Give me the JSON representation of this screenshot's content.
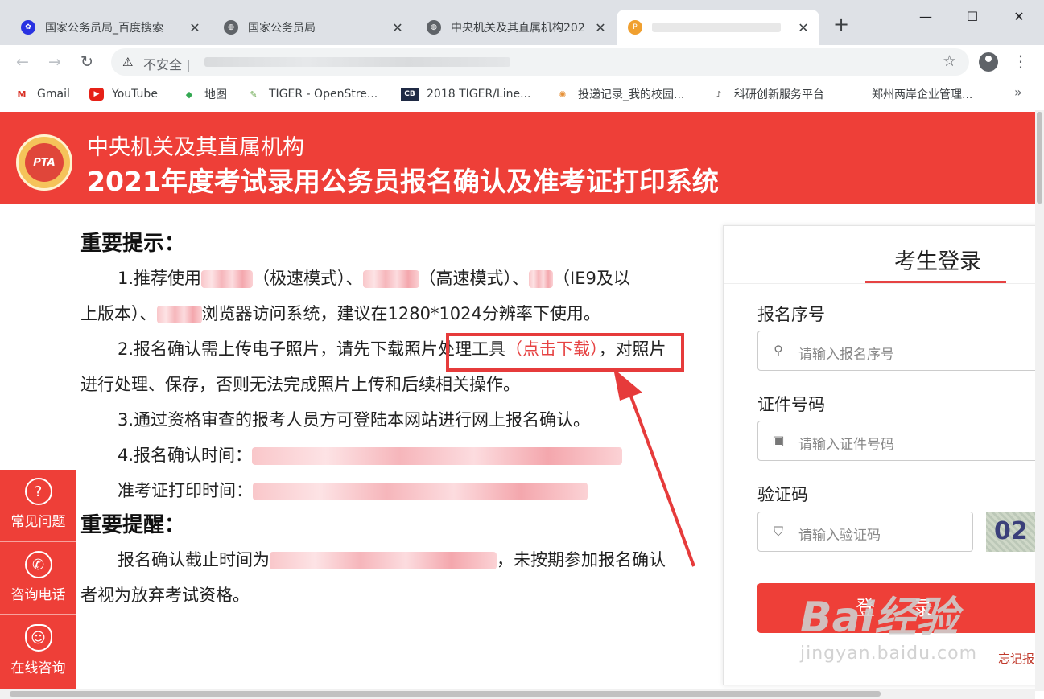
{
  "browser": {
    "tabs": [
      {
        "title": "国家公务员局_百度搜索",
        "favicon": "paw-icon",
        "close": "✕"
      },
      {
        "title": "国家公务员局",
        "favicon": "globe-icon",
        "close": "✕"
      },
      {
        "title": "中央机关及其直属机构202",
        "favicon": "globe-icon",
        "close": "✕"
      },
      {
        "title": "",
        "favicon": "pta-icon",
        "close": "✕"
      }
    ],
    "new_tab": "+",
    "address": {
      "security_label": "不安全 |"
    },
    "bookmarks": [
      {
        "label": "Gmail",
        "icon": "gmail-icon"
      },
      {
        "label": "YouTube",
        "icon": "youtube-icon"
      },
      {
        "label": "地图",
        "icon": "maps-icon"
      },
      {
        "label": "TIGER - OpenStre...",
        "icon": "tiger-icon"
      },
      {
        "label": "2018 TIGER/Line...",
        "icon": "cb-icon"
      },
      {
        "label": "投递记录_我的校园...",
        "icon": "flower-icon"
      },
      {
        "label": "科研创新服务平台",
        "icon": "note-icon"
      },
      {
        "label": "郑州两岸企业管理...",
        "icon": ""
      }
    ],
    "bookmarks_more": "»"
  },
  "header": {
    "subtitle": "中央机关及其直属机构",
    "title": "2021年度考试录用公务员报名确认及准考证打印系统",
    "logo_text": "PTA"
  },
  "notice": {
    "heading": "重要提示：",
    "item1_a": "1.推荐使用",
    "item1_b": "（极速模式）、",
    "item1_c": "（高速模式）、",
    "item1_d": "（IE9及以",
    "item1_e": "上版本）、",
    "item1_f": "浏览器访问系统，建议在1280*1024分辨率下使用。",
    "item2_a": "2.报名确认需上传电子照片，请先下载照片处理工具",
    "item2_link": "（点击下载）",
    "item2_b": "，对照片进行处理、保存，否则无法完成照片上传和后续相关操作。",
    "item3": "3.通过资格审查的报考人员方可登陆本网站进行网上报名确认。",
    "item4": "4.报名确认时间：",
    "item4_b": "准考证打印时间：",
    "reminder_heading": "重要提醒：",
    "reminder_a": "报名确认截止时间为",
    "reminder_b": "，未按期参加报名确认者视为放弃考试资格。"
  },
  "side_float": [
    {
      "label": "常见问题",
      "icon": "question-icon"
    },
    {
      "label": "咨询电话",
      "icon": "phone-icon"
    },
    {
      "label": "在线咨询",
      "icon": "headset-icon"
    }
  ],
  "login": {
    "title": "考生登录",
    "reg_label": "报名序号",
    "reg_placeholder": "请输入报名序号",
    "id_label": "证件号码",
    "id_placeholder": "请输入证件号码",
    "captcha_label": "验证码",
    "captcha_placeholder": "请输入验证码",
    "captcha_text": "02",
    "submit": "登 录",
    "forgot": "忘记报"
  },
  "watermark": {
    "brand": "Bai经验",
    "url": "jingyan.baidu.com"
  },
  "colors": {
    "brand_red": "#ee3f38",
    "link_red": "#e64343"
  }
}
